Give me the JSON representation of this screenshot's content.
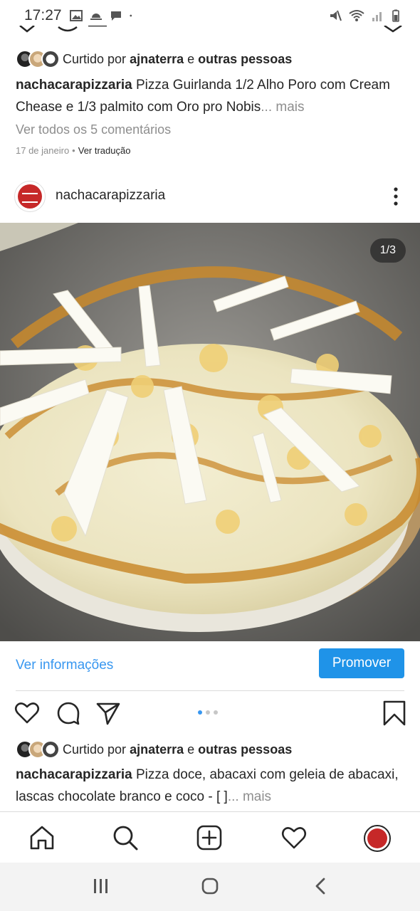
{
  "status_bar": {
    "time": "17:27"
  },
  "prev_post": {
    "likes": {
      "prefix": "Curtido por",
      "user": "ajnaterra",
      "joiner": "e",
      "others": "outras pessoas"
    },
    "caption": {
      "username": "nachacarapizzaria",
      "text": "Pizza Guirlanda  1/2 Alho Poro com Cream Chease e 1/3 palmito com Oro pro Nobis",
      "more": "... mais"
    },
    "comments_link": "Ver todos os 5 comentários",
    "date": "17 de janeiro",
    "date_separator": "•",
    "translate": "Ver tradução"
  },
  "post": {
    "username": "nachacarapizzaria",
    "counter": "1/3",
    "info_link": "Ver informações",
    "promote_label": "Promover",
    "likes": {
      "prefix": "Curtido por",
      "user": "ajnaterra",
      "joiner": "e",
      "others": "outras pessoas"
    },
    "caption": {
      "username": "nachacarapizzaria",
      "text": "Pizza doce, abacaxi com geleia de abacaxi, lascas chocolate branco e coco - [ ]",
      "more": "... mais"
    },
    "carousel": {
      "total": 3,
      "current": 1
    }
  },
  "icons": {
    "heart": "heart-icon",
    "comment": "comment-icon",
    "share": "send-icon",
    "save": "bookmark-icon",
    "home": "home-icon",
    "search": "search-icon",
    "add": "add-post-icon",
    "activity": "heart-icon",
    "profile": "profile-avatar"
  },
  "colors": {
    "link_blue": "#3897f0",
    "promote_blue": "#1f93e8",
    "text": "#262626",
    "muted": "#8e8e8e",
    "brand_red": "#c62828"
  }
}
